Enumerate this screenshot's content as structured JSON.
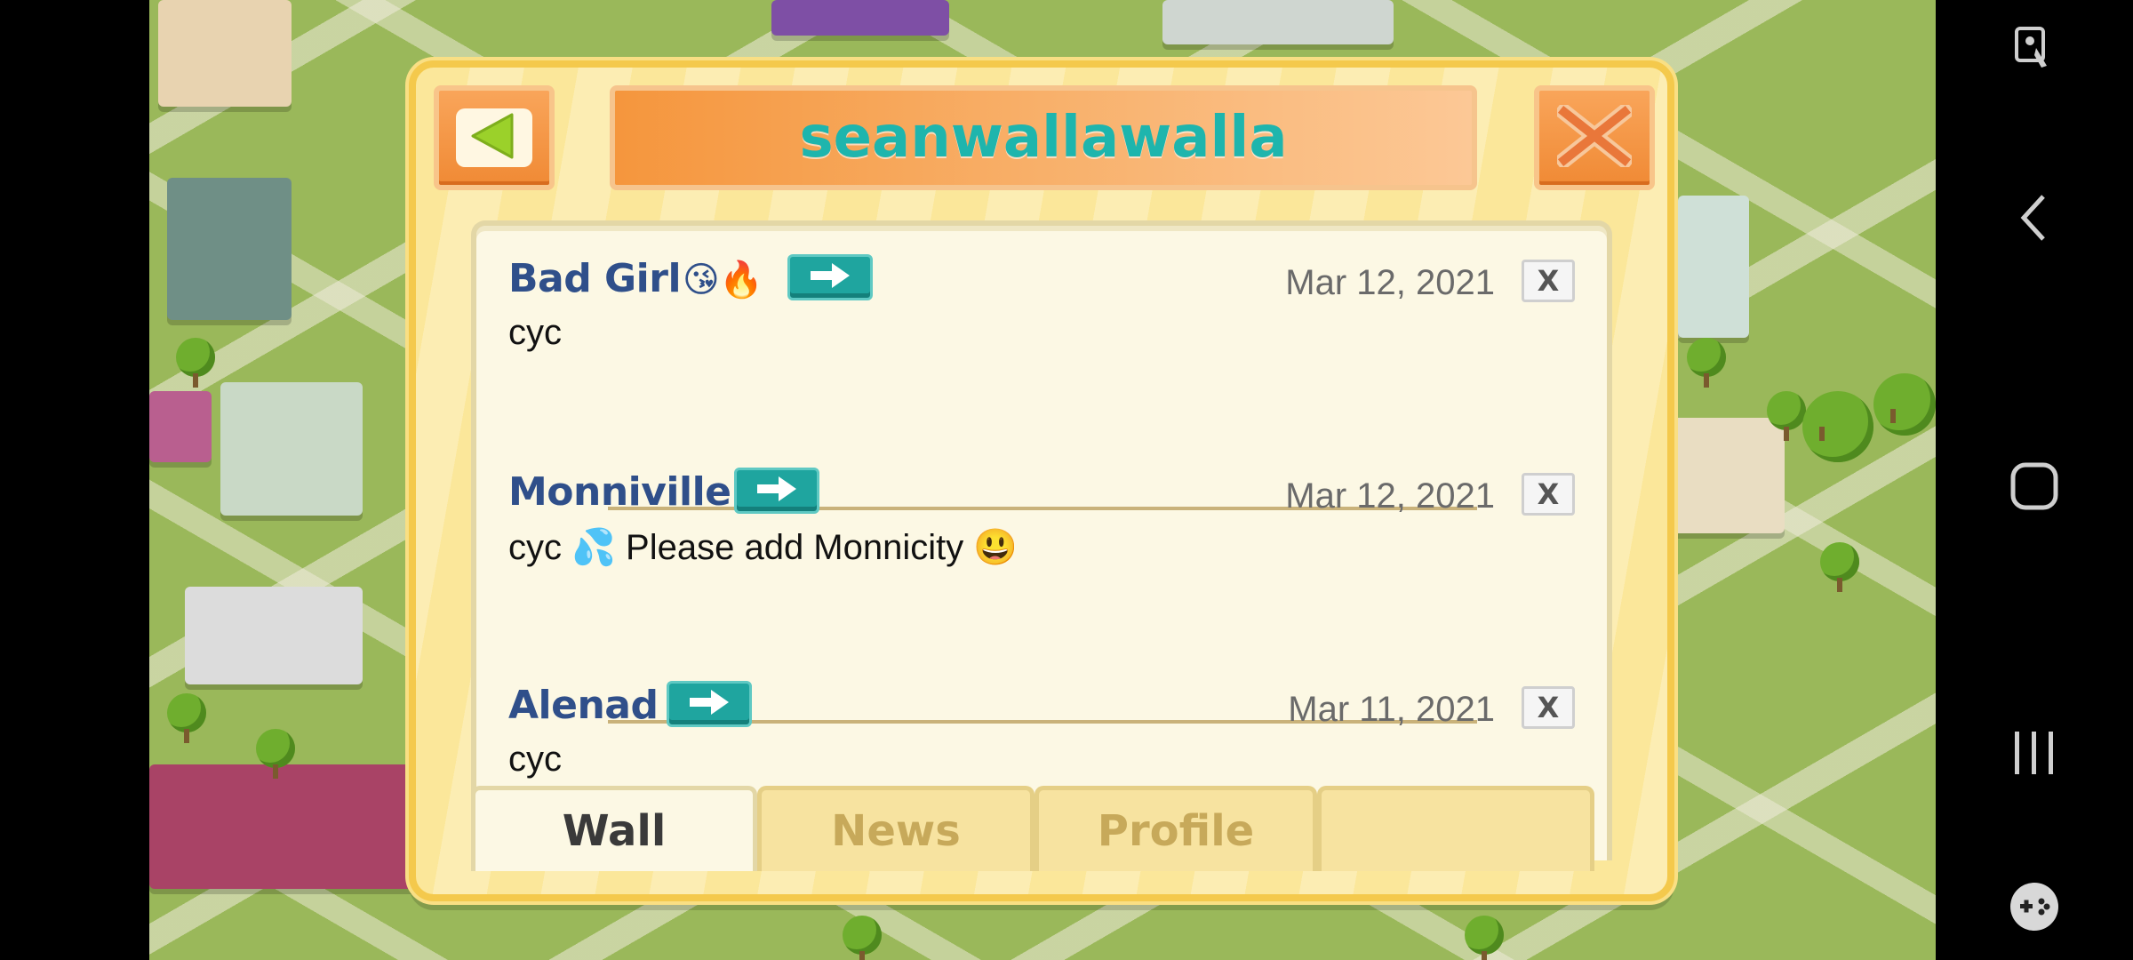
{
  "popup": {
    "title": "seanwallawalla",
    "back_icon": "triangle-left-icon",
    "close_icon": "x-close-icon"
  },
  "wall": {
    "posts": [
      {
        "author": "Bad Girl",
        "author_emoji": "😘🔥",
        "date": "Mar 12, 2021",
        "message": "cyc"
      },
      {
        "author": "Monniville",
        "author_emoji": "",
        "date": "Mar 12, 2021",
        "message": "cyc 💦 Please add Monnicity 😃"
      },
      {
        "author": "Alenad",
        "author_emoji": "",
        "date": "Mar 11, 2021",
        "message": "cyc"
      }
    ],
    "delete_label": "X"
  },
  "tabs": [
    {
      "label": "Wall",
      "active": true
    },
    {
      "label": "News",
      "active": false
    },
    {
      "label": "Profile",
      "active": false
    },
    {
      "label": "",
      "active": false
    }
  ],
  "colors": {
    "title_text": "#1eb5ad",
    "author_text": "#2f4f8a",
    "go_button": "#1fa59f",
    "panel_bg": "#fbe79a",
    "header_orange": "#f5963d"
  },
  "system_nav": {
    "icons": [
      "accessibility-icon",
      "back-icon",
      "home-icon",
      "recents-icon",
      "game-tools-icon"
    ]
  }
}
